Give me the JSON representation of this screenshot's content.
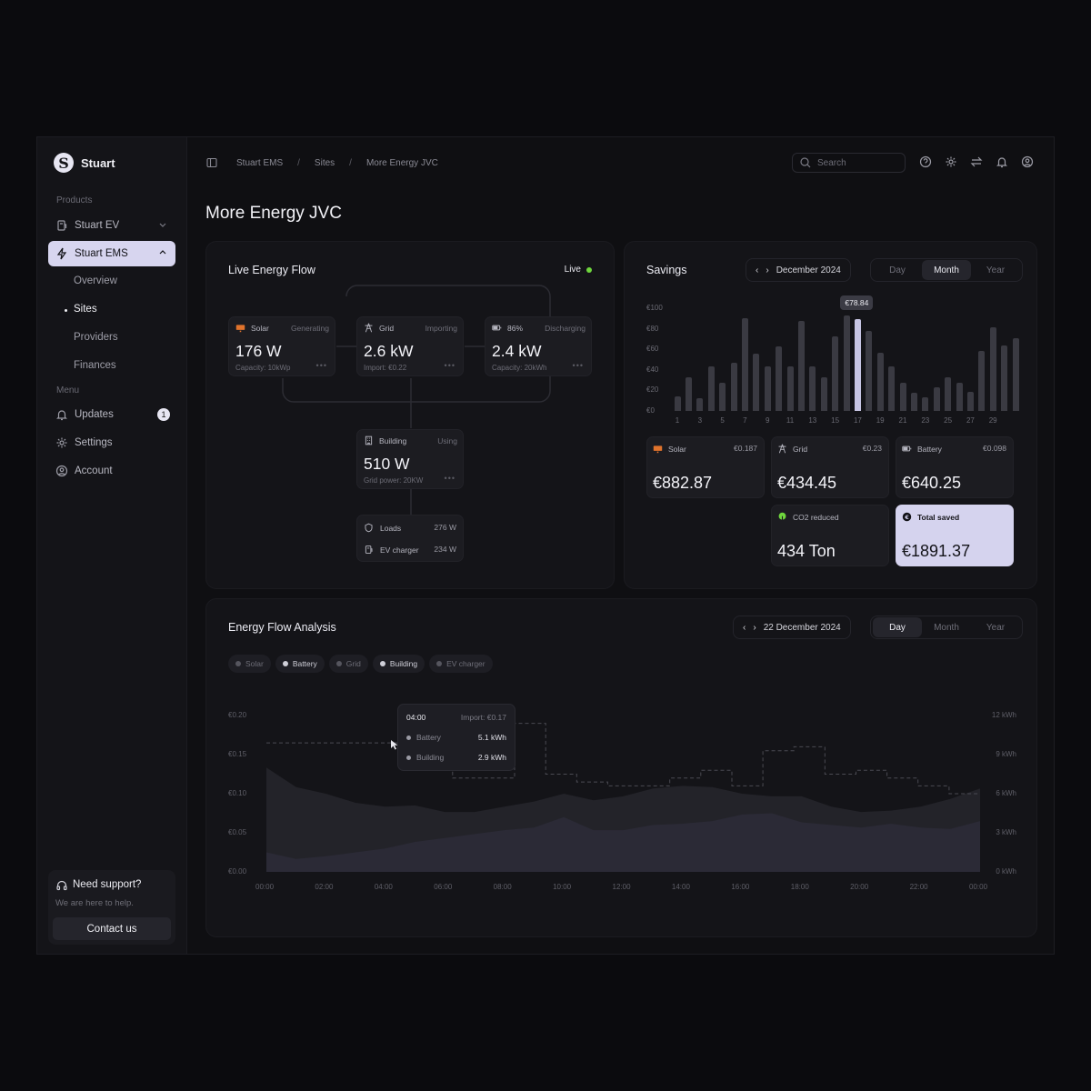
{
  "app": {
    "name": "Stuart"
  },
  "sidebar": {
    "products_label": "Products",
    "menu_label": "Menu",
    "items": [
      {
        "label": "Stuart EV"
      },
      {
        "label": "Stuart EMS"
      }
    ],
    "sub_items": [
      {
        "label": "Overview"
      },
      {
        "label": "Sites"
      },
      {
        "label": "Providers"
      },
      {
        "label": "Finances"
      }
    ],
    "menu_items": [
      {
        "label": "Updates",
        "badge": "1"
      },
      {
        "label": "Settings"
      },
      {
        "label": "Account"
      }
    ],
    "support": {
      "title": "Need support?",
      "desc": "We are here to help.",
      "button": "Contact us"
    }
  },
  "breadcrumb": [
    "Stuart EMS",
    "Sites",
    "More Energy JVC"
  ],
  "search": {
    "placeholder": "Search"
  },
  "page_title": "More Energy JVC",
  "live_flow": {
    "title": "Live Energy Flow",
    "live_label": "Live",
    "solar": {
      "label": "Solar",
      "status": "Generating",
      "value": "176 W",
      "sub": "Capacity: 10kWp"
    },
    "grid": {
      "label": "Grid",
      "status": "Importing",
      "value": "2.6 kW",
      "sub": "Import: €0.22"
    },
    "battery": {
      "label": "86%",
      "status": "Discharging",
      "value": "2.4 kW",
      "sub": "Capacity: 20kWh"
    },
    "building": {
      "label": "Building",
      "status": "Using",
      "value": "510 W",
      "sub": "Grid power: 20KW"
    },
    "loads": [
      {
        "label": "Loads",
        "value": "276 W"
      },
      {
        "label": "EV charger",
        "value": "234 W"
      }
    ]
  },
  "savings": {
    "title": "Savings",
    "period": "December 2024",
    "segments": [
      "Day",
      "Month",
      "Year"
    ],
    "active_segment": "Month",
    "tooltip": "€78.84",
    "cards": [
      {
        "label": "Solar",
        "rate": "€0.187",
        "value": "€882.87"
      },
      {
        "label": "Grid",
        "rate": "€0.23",
        "value": "€434.45"
      },
      {
        "label": "Battery",
        "rate": "€0.098",
        "value": "€640.25"
      },
      {
        "label": "CO2 reduced",
        "rate": "",
        "value": "434 Ton"
      },
      {
        "label": "Total saved",
        "rate": "",
        "value": "€1891.37"
      }
    ]
  },
  "chart_data": [
    {
      "type": "bar",
      "title": "Savings",
      "y_ticks": [
        "€100",
        "€80",
        "€60",
        "€40",
        "€20",
        "€0"
      ],
      "ylim": [
        0,
        100
      ],
      "x_ticks": [
        "1",
        "3",
        "5",
        "7",
        "9",
        "11",
        "13",
        "15",
        "17",
        "19",
        "21",
        "23",
        "25",
        "27",
        "29"
      ],
      "categories": [
        1,
        2,
        3,
        4,
        5,
        6,
        7,
        8,
        9,
        10,
        11,
        12,
        13,
        14,
        15,
        16,
        17,
        18,
        19,
        20,
        21,
        22,
        23,
        24,
        25,
        26,
        27,
        28,
        29,
        30,
        31
      ],
      "values": [
        14,
        33,
        12,
        43,
        27,
        47,
        90,
        56,
        43,
        63,
        43,
        88,
        43,
        33,
        73,
        93,
        89,
        78,
        57,
        43,
        27,
        18,
        13,
        23,
        33,
        27,
        19,
        58,
        81,
        64,
        71
      ],
      "highlight_index": 16
    },
    {
      "type": "area",
      "title": "Energy Flow Analysis",
      "period": "22 December 2024",
      "x_ticks": [
        "00:00",
        "02:00",
        "04:00",
        "06:00",
        "08:00",
        "10:00",
        "12:00",
        "14:00",
        "16:00",
        "18:00",
        "20:00",
        "22:00",
        "00:00"
      ],
      "y_left_ticks": [
        "€0.20",
        "€0.15",
        "€0.10",
        "€0.05",
        "€0.00"
      ],
      "y_right_ticks": [
        "12 kWh",
        "9 kWh",
        "6 kWh",
        "3 kWh",
        "0 kWh"
      ],
      "series": [
        {
          "name": "Building",
          "unit": "kWh",
          "values": [
            8,
            6.5,
            6,
            5.3,
            5,
            5.1,
            4.6,
            4.6,
            5,
            5.4,
            6,
            5.5,
            5.8,
            6.4,
            6.6,
            6.5,
            6,
            5.8,
            5.8,
            5,
            4.6,
            4.7,
            5,
            5.6,
            6.4
          ]
        },
        {
          "name": "Battery",
          "unit": "kWh",
          "values": [
            1.5,
            1,
            1.2,
            1.5,
            1.8,
            2.3,
            2.6,
            2.9,
            3.2,
            3.4,
            4.2,
            3.2,
            3.2,
            3.6,
            3.7,
            3.9,
            4.4,
            4.5,
            3.8,
            3.6,
            3.4,
            3.7,
            3.4,
            3.3,
            3.9
          ]
        },
        {
          "name": "Import price",
          "unit": "€",
          "values": [
            0.165,
            0.165,
            0.165,
            0.165,
            0.165,
            0.17,
            0.12,
            0.12,
            0.19,
            0.125,
            0.115,
            0.11,
            0.11,
            0.12,
            0.13,
            0.11,
            0.155,
            0.16,
            0.125,
            0.13,
            0.12,
            0.11,
            0.1
          ]
        }
      ],
      "legend": [
        "Solar",
        "Battery",
        "Grid",
        "Building",
        "EV charger"
      ],
      "legend_active": [
        "Battery",
        "Building"
      ],
      "tooltip": {
        "time": "04:00",
        "import": "Import: €0.17",
        "rows": [
          {
            "label": "Battery",
            "value": "5.1 kWh"
          },
          {
            "label": "Building",
            "value": "2.9 kWh"
          }
        ]
      }
    }
  ],
  "analysis": {
    "title": "Energy Flow Analysis",
    "period": "22 December 2024",
    "segments": [
      "Day",
      "Month",
      "Year"
    ],
    "active_segment": "Day"
  }
}
